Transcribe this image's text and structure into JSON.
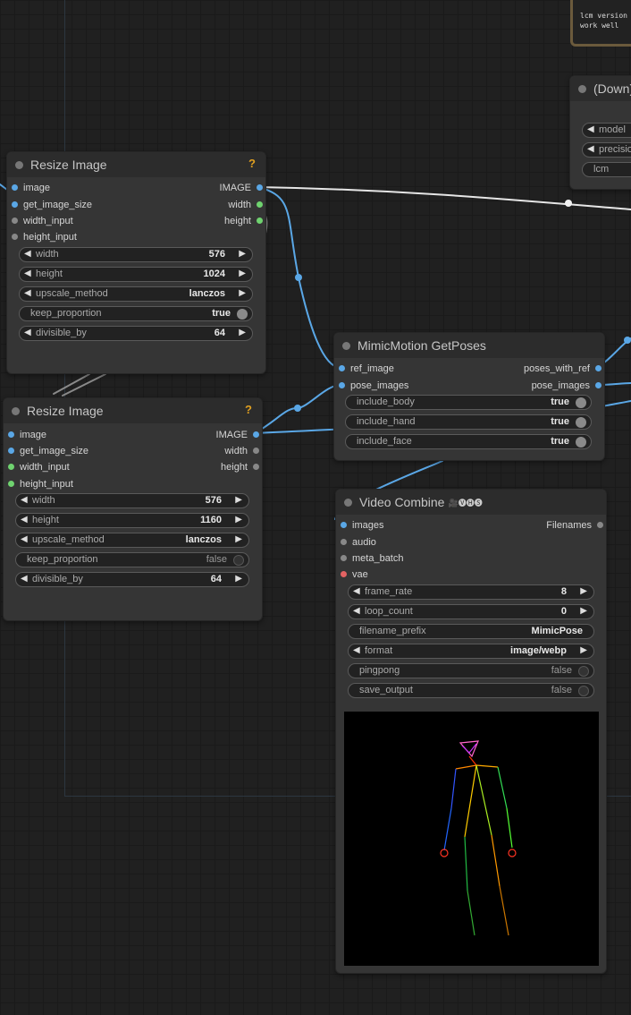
{
  "note": {
    "text": "lcm version\nwork well"
  },
  "down_node": {
    "title": "(Down)",
    "widgets": [
      "model",
      "precisio",
      "lcm"
    ]
  },
  "resize1": {
    "title": "Resize Image",
    "badge": "?",
    "inputs": [
      "image",
      "get_image_size",
      "width_input",
      "height_input"
    ],
    "outputs": [
      "IMAGE",
      "width",
      "height"
    ],
    "widgets": [
      {
        "label": "width",
        "value": "576"
      },
      {
        "label": "height",
        "value": "1024"
      },
      {
        "label": "upscale_method",
        "value": "lanczos"
      },
      {
        "label": "keep_proportion",
        "value": "true"
      },
      {
        "label": "divisible_by",
        "value": "64"
      }
    ]
  },
  "resize2": {
    "title": "Resize Image",
    "badge": "?",
    "inputs": [
      "image",
      "get_image_size",
      "width_input",
      "height_input"
    ],
    "outputs": [
      "IMAGE",
      "width",
      "height"
    ],
    "widgets": [
      {
        "label": "width",
        "value": "576"
      },
      {
        "label": "height",
        "value": "1160"
      },
      {
        "label": "upscale_method",
        "value": "lanczos"
      },
      {
        "label": "keep_proportion",
        "value": "false"
      },
      {
        "label": "divisible_by",
        "value": "64"
      }
    ]
  },
  "getposes": {
    "title": "MimicMotion GetPoses",
    "inputs": [
      "ref_image",
      "pose_images"
    ],
    "outputs": [
      "poses_with_ref",
      "pose_images"
    ],
    "widgets": [
      {
        "label": "include_body",
        "value": "true"
      },
      {
        "label": "include_hand",
        "value": "true"
      },
      {
        "label": "include_face",
        "value": "true"
      }
    ]
  },
  "video": {
    "title": "Video Combine",
    "title_icons": "🎥🅥🅗🅢",
    "inputs": [
      "images",
      "audio",
      "meta_batch",
      "vae"
    ],
    "outputs": [
      "Filenames"
    ],
    "widgets": [
      {
        "label": "frame_rate",
        "value": "8"
      },
      {
        "label": "loop_count",
        "value": "0"
      },
      {
        "label": "filename_prefix",
        "value": "MimicPose"
      },
      {
        "label": "format",
        "value": "image/webp"
      },
      {
        "label": "pingpong",
        "value": "false"
      },
      {
        "label": "save_output",
        "value": "false"
      }
    ]
  },
  "colors": {
    "image_slot": "#5aa7e6",
    "int_slot": "#6fd36f",
    "vae_slot": "#e36363",
    "link": "#5aa7e6"
  }
}
